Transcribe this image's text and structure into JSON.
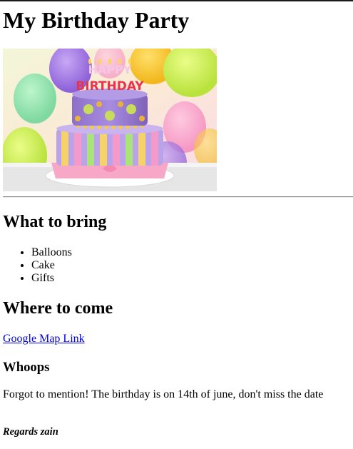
{
  "page": {
    "title": "My Birthday Party",
    "image": {
      "description": "birthday-cake-with-balloons",
      "candle_letters": "HAPPY BIRTHDAY"
    },
    "bring_section": {
      "heading": "What to bring",
      "items": [
        "Balloons",
        "Cake",
        "Gifts"
      ]
    },
    "where_section": {
      "heading": "Where to come",
      "link_text": "Google Map Link"
    },
    "whoops_section": {
      "heading": "Whoops",
      "text": "Forgot to mention! The birthday is on 14th of june, don't miss the date"
    },
    "signature": "Regards zain"
  },
  "colors": {
    "link": "#0000ee",
    "text": "#000000",
    "rule": "#8a8a8a"
  }
}
